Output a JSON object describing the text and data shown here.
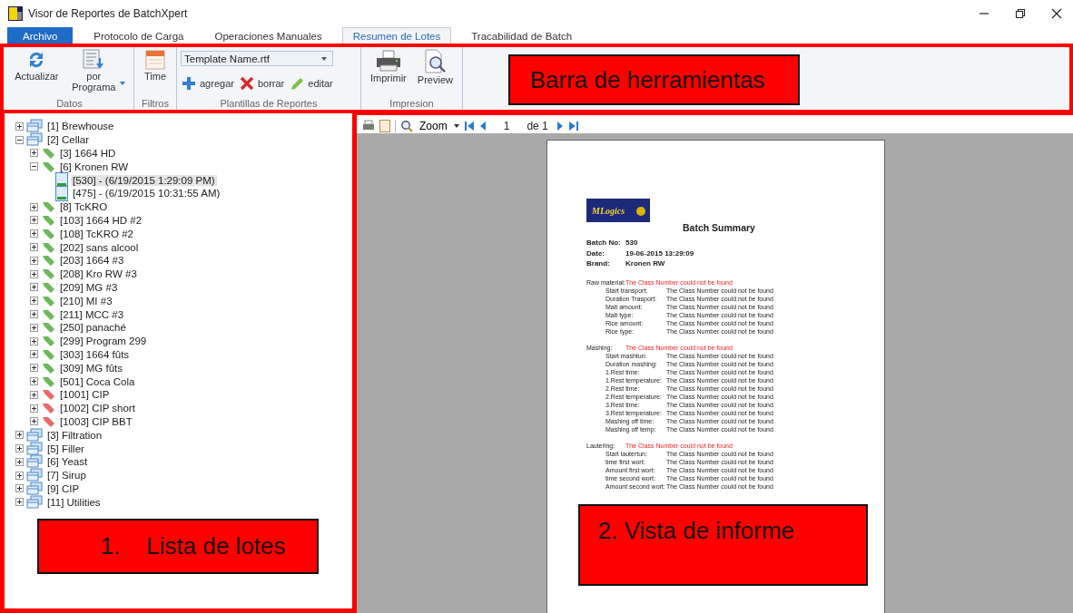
{
  "window": {
    "title": "Visor de Reportes de BatchXpert"
  },
  "tabs": [
    {
      "label": "Archivo",
      "kind": "file",
      "selected": false
    },
    {
      "label": "Protocolo de Carga",
      "kind": "tab",
      "selected": false
    },
    {
      "label": "Operaciones Manuales",
      "kind": "tab",
      "selected": false
    },
    {
      "label": "Resumen de Lotes",
      "kind": "tab",
      "selected": true
    },
    {
      "label": "Tracabilidad de Batch",
      "kind": "tab",
      "selected": false
    }
  ],
  "toolbar": {
    "groups": [
      {
        "label": "Datos",
        "items": [
          {
            "kind": "large",
            "label": "Actualizar"
          },
          {
            "kind": "large",
            "label": "por Programa",
            "caret": true
          }
        ]
      },
      {
        "label": "Filtros",
        "items": [
          {
            "kind": "large",
            "label": "Time"
          }
        ]
      },
      {
        "label": "Plantillas de Reportes",
        "items": [
          {
            "kind": "dropdown",
            "value": "Template Name.rtf"
          },
          {
            "kind": "small",
            "label": "agregar"
          },
          {
            "kind": "small",
            "label": "borrar"
          },
          {
            "kind": "small",
            "label": "editar"
          }
        ]
      },
      {
        "label": "Impresion",
        "items": [
          {
            "kind": "large",
            "label": "Imprimir"
          },
          {
            "kind": "large",
            "label": "Preview"
          }
        ]
      }
    ]
  },
  "tree": [
    {
      "kind": "area",
      "label": "[1] Brewhouse",
      "expanded": false
    },
    {
      "kind": "area",
      "label": "[2] Cellar",
      "expanded": true,
      "children": [
        {
          "kind": "program",
          "label": "[3] 1664 HD",
          "color": "#6cb85a",
          "expanded": false
        },
        {
          "kind": "program",
          "label": "[6] Kronen RW",
          "color": "#6cb85a",
          "expanded": true,
          "children": [
            {
              "kind": "batch",
              "label": "[530] - (6/19/2015 1:29:09 PM)",
              "selected": true
            },
            {
              "kind": "batch",
              "label": "[475] - (6/19/2015 10:31:55 AM)",
              "selected": false
            }
          ]
        },
        {
          "kind": "program",
          "label": "[8] TcKRO",
          "color": "#6cb85a",
          "expanded": false
        },
        {
          "kind": "program",
          "label": "[103] 1664 HD #2",
          "color": "#6cb85a",
          "expanded": false
        },
        {
          "kind": "program",
          "label": "[108] TcKRO #2",
          "color": "#6cb85a",
          "expanded": false
        },
        {
          "kind": "program",
          "label": "[202] sans alcool",
          "color": "#6cb85a",
          "expanded": false
        },
        {
          "kind": "program",
          "label": "[203] 1664  #3",
          "color": "#6cb85a",
          "expanded": false
        },
        {
          "kind": "program",
          "label": "[208] Kro RW #3",
          "color": "#6cb85a",
          "expanded": false
        },
        {
          "kind": "program",
          "label": "[209] MG #3",
          "color": "#6cb85a",
          "expanded": false
        },
        {
          "kind": "program",
          "label": "[210] MI #3",
          "color": "#6cb85a",
          "expanded": false
        },
        {
          "kind": "program",
          "label": "[211] MCC #3",
          "color": "#6cb85a",
          "expanded": false
        },
        {
          "kind": "program",
          "label": "[250] panaché",
          "color": "#6cb85a",
          "expanded": false
        },
        {
          "kind": "program",
          "label": "[299] Program 299",
          "color": "#6cb85a",
          "expanded": false
        },
        {
          "kind": "program",
          "label": "[303] 1664 fûts",
          "color": "#6cb85a",
          "expanded": false
        },
        {
          "kind": "program",
          "label": "[309] MG fûts",
          "color": "#6cb85a",
          "expanded": false
        },
        {
          "kind": "program",
          "label": "[501] Coca Cola",
          "color": "#6cb85a",
          "expanded": false
        },
        {
          "kind": "program",
          "label": "[1001] CIP",
          "color": "#e86a6a",
          "expanded": false
        },
        {
          "kind": "program",
          "label": "[1002] CIP short",
          "color": "#e86a6a",
          "expanded": false
        },
        {
          "kind": "program",
          "label": "[1003] CIP BBT",
          "color": "#e86a6a",
          "expanded": false
        }
      ]
    },
    {
      "kind": "area",
      "label": "[3] Filtration",
      "expanded": false
    },
    {
      "kind": "area",
      "label": "[5] Filler",
      "expanded": false
    },
    {
      "kind": "area",
      "label": "[6] Yeast",
      "expanded": false
    },
    {
      "kind": "area",
      "label": "[7] Sirup",
      "expanded": false
    },
    {
      "kind": "area",
      "label": "[9] CIP",
      "expanded": false
    },
    {
      "kind": "area",
      "label": "[11] Utilities",
      "expanded": false
    }
  ],
  "report_toolbar": {
    "zoom": "Zoom",
    "page": "1",
    "page_total": "de 1"
  },
  "report": {
    "logo": "MLogics",
    "title": "Batch Summary",
    "fields": [
      {
        "label": "Batch No:",
        "value": "530"
      },
      {
        "label": "Date:",
        "value": "19-06-2015 13:29:09"
      },
      {
        "label": "Brand:",
        "value": "Kronen RW"
      }
    ],
    "sections": [
      {
        "label": "Raw material:",
        "note": "The Class Number could not be found",
        "rows": [
          {
            "label": "Start transport:",
            "value": "The Class Number could not be found"
          },
          {
            "label": "Duration Trasport:",
            "value": "The Class Number could not be found"
          },
          {
            "label": "Malt amount:",
            "value": "The Class Number could not be found"
          },
          {
            "label": "Malt type:",
            "value": "The Class Number could not be found"
          },
          {
            "label": "Rice amount:",
            "value": "The Class Number could not be found"
          },
          {
            "label": "Rice type:",
            "value": "The Class Number could not be found"
          }
        ]
      },
      {
        "label": "Mashing:",
        "note": "The Class Number could not be found",
        "rows": [
          {
            "label": "Start mashtun:",
            "value": "The Class Number could not be found"
          },
          {
            "label": "Duration mashing:",
            "value": "The Class Number could not be found"
          },
          {
            "label": "1.Rest time:",
            "value": "The Class Number could not be found"
          },
          {
            "label": "1.Rest temperature:",
            "value": "The Class Number could not be found"
          },
          {
            "label": "2.Rest time:",
            "value": "The Class Number could not be found"
          },
          {
            "label": "2.Rest temperature:",
            "value": "The Class Number could not be found"
          },
          {
            "label": "3.Rest time:",
            "value": "The Class Number could not be found"
          },
          {
            "label": "3.Rest temperature:",
            "value": "The Class Number could not be found"
          },
          {
            "label": "Mashing off time:",
            "value": "The Class Number could not be found"
          },
          {
            "label": "Mashing off temp:",
            "value": "The Class Number could not be found"
          }
        ]
      },
      {
        "label": "Lautering:",
        "note": "The Class Number could not be found",
        "rows": [
          {
            "label": "Start lautertun:",
            "value": "The Class Number could not be found"
          },
          {
            "label": "time first wort:",
            "value": "The Class Number could not be found"
          },
          {
            "label": "Amount first wort:",
            "value": "The Class Number could not be found"
          },
          {
            "label": "time second wort:",
            "value": "The Class Number could not be found"
          },
          {
            "label": "Amount second wort:",
            "value": "The Class Number could not be found"
          }
        ]
      }
    ]
  },
  "annotations": [
    {
      "text": "Barra de herramientas"
    },
    {
      "text": "1.    Lista de lotes"
    },
    {
      "text": "2. Vista de informe"
    }
  ]
}
